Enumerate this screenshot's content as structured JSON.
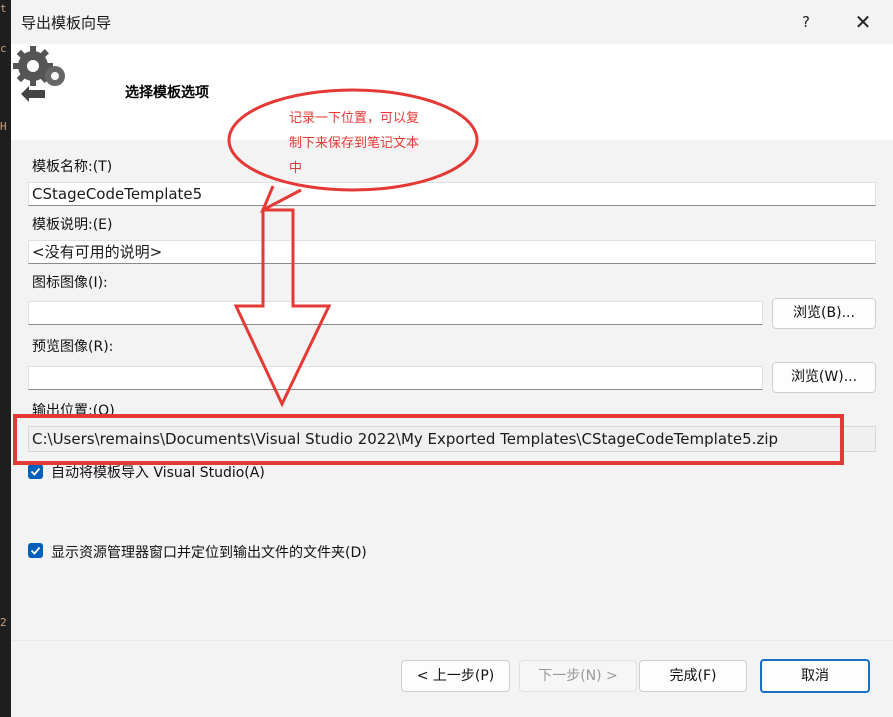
{
  "dialog": {
    "title": "导出模板向导",
    "help_label": "?",
    "close_label": "✕",
    "header": "选择模板选项"
  },
  "fields": {
    "template_name_label": "模板名称:(T)",
    "template_name_value": "CStageCodeTemplate5",
    "template_desc_label": "模板说明:(E)",
    "template_desc_value": "<没有可用的说明>",
    "icon_image_label": "图标图像(I):",
    "icon_image_value": "",
    "icon_browse_label": "浏览(B)...",
    "preview_image_label": "预览图像(R):",
    "preview_image_value": "",
    "preview_browse_label": "浏览(W)...",
    "output_location_label": "输出位置:(O)",
    "output_location_value": "C:\\Users\\remains\\Documents\\Visual Studio 2022\\My Exported Templates\\CStageCodeTemplate5.zip"
  },
  "options": {
    "auto_import_label": "自动将模板导入 Visual Studio(A)",
    "auto_import_checked": true,
    "show_explorer_label": "显示资源管理器窗口并定位到输出文件的文件夹(D)",
    "show_explorer_checked": true
  },
  "buttons": {
    "prev": "< 上一步(P)",
    "next": "下一步(N) >",
    "finish": "完成(F)",
    "cancel": "取消"
  },
  "annotation": {
    "callout_text": "记录一下位置，可以复制下来保存到笔记文本中",
    "color": "#e53935"
  },
  "colors": {
    "accent": "#005fb8",
    "dialog_bg": "#f3f3f3"
  }
}
